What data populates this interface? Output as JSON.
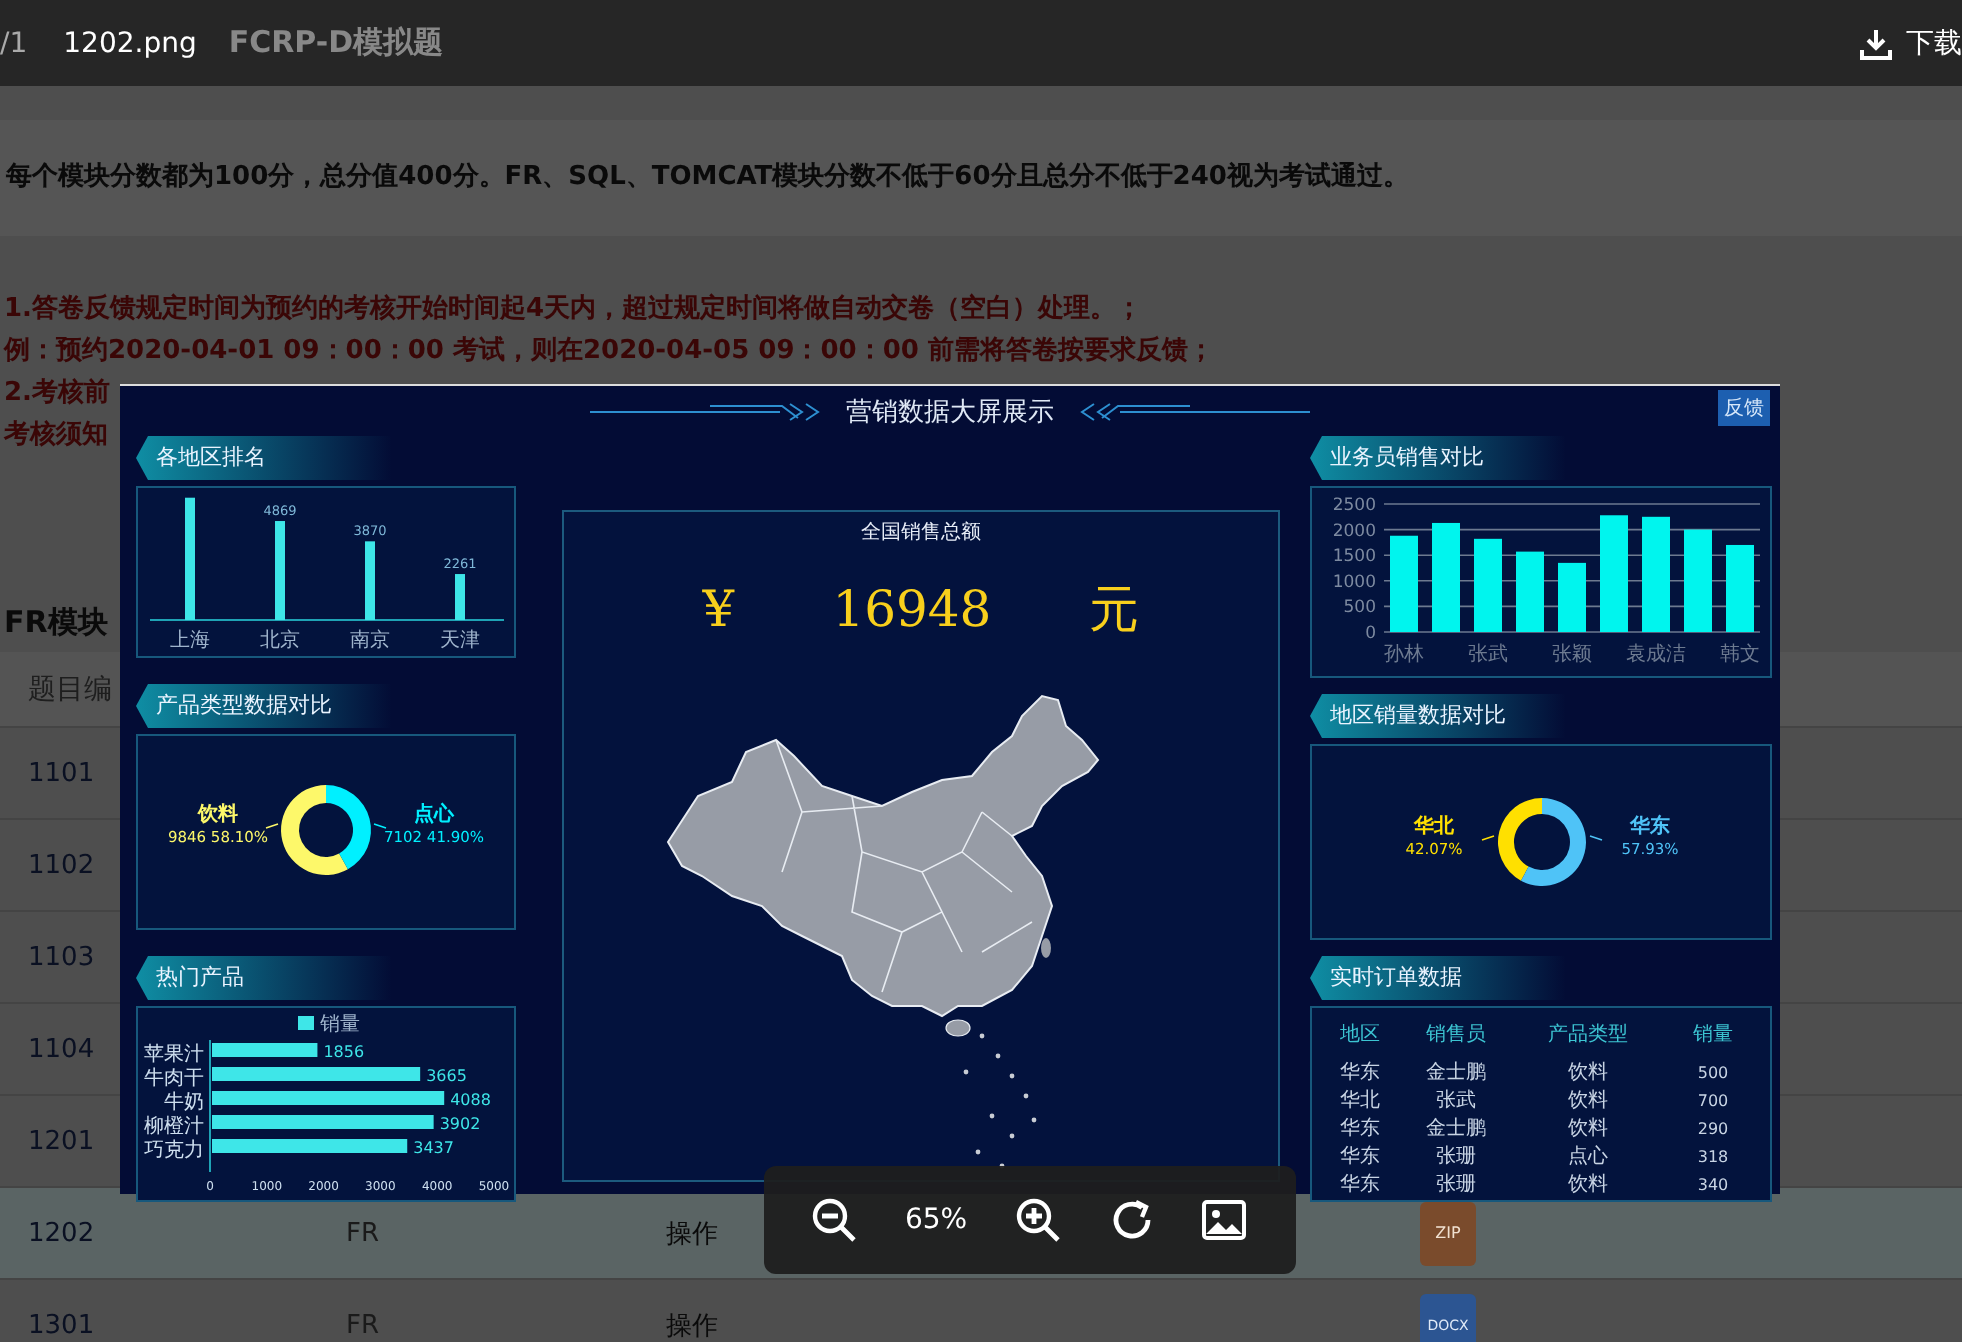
{
  "viewer": {
    "page_count": "/1",
    "file_name": "1202.png",
    "download": "下载",
    "zoom": "65%"
  },
  "page": {
    "title": "FCRP-D模拟题",
    "notice": "每个模块分数都为100分，总分值400分。FR、SQL、TOMCAT模块分数不低于60分且总分不低于240视为考试通过。",
    "rules": [
      "1.答卷反馈规定时间为预约的考核开始时间起4天内，超过规定时间将做自动交卷（空白）处理。；",
      "例：预约2020-04-01 09：00：00 考试，则在2020-04-05 09：00：00 前需将答卷按要求反馈；",
      "2.考核前",
      "考核须知"
    ],
    "section": "FR模块",
    "table": {
      "header": "题目编",
      "rows": [
        {
          "id": "1101",
          "selected": false
        },
        {
          "id": "1102",
          "selected": false
        },
        {
          "id": "1103",
          "selected": false
        },
        {
          "id": "1104",
          "selected": false
        },
        {
          "id": "1201",
          "selected": false
        },
        {
          "id": "1202",
          "module": "FR",
          "action": "操作",
          "file": {
            "kind": "zip",
            "label": "ZIP"
          },
          "selected": true
        },
        {
          "id": "1301",
          "module": "FR",
          "action": "操作",
          "file": {
            "kind": "docx",
            "label": "DOCX"
          },
          "selected": false
        }
      ]
    }
  },
  "dashboard": {
    "title": "营销数据大屏展示",
    "feedback": "反馈",
    "left_panels": [
      {
        "kind": "chart",
        "title": "各地区排名",
        "chart_data": {
          "type": "bar",
          "categories": [
            "上海",
            "北京",
            "南京",
            "天津"
          ],
          "values": [
            6016,
            4869,
            3870,
            2261
          ],
          "value_labels": [
            null,
            "4869",
            "3870",
            "2261"
          ]
        }
      },
      {
        "kind": "chart",
        "title": "产品类型数据对比",
        "chart_data": {
          "type": "donut",
          "categories": [
            "饮料",
            "点心"
          ],
          "values": [
            58.1,
            41.9
          ]
        },
        "slices": [
          {
            "value_text": "9846 58.10%",
            "color": "#fdf86a"
          },
          {
            "value_text": "7102 41.90%",
            "color": "#00f0ff"
          }
        ]
      },
      {
        "kind": "chart",
        "title": "热门产品",
        "chart_data": {
          "type": "bar",
          "orientation": "horizontal",
          "categories": [
            "苹果汁",
            "牛肉干",
            "牛奶",
            "柳橙汁",
            "巧克力"
          ],
          "series": [
            {
              "name": "销量",
              "values": [
                1856,
                3665,
                4088,
                3902,
                3437
              ]
            }
          ],
          "xlim": [
            0,
            5000
          ],
          "xticks": [
            0,
            1000,
            2000,
            3000,
            4000,
            5000
          ],
          "data_labels": true
        }
      }
    ],
    "center": {
      "title": "全国销售总额",
      "currency": "¥",
      "amount": "16948",
      "unit": "元"
    },
    "right_panels": [
      {
        "kind": "chart",
        "title": "业务员销售对比",
        "chart_data": {
          "type": "bar",
          "categories": [
            "孙林",
            null,
            "张武",
            null,
            "张颖",
            null,
            "袁成洁",
            null,
            "韩文"
          ],
          "values": [
            1880,
            2130,
            1820,
            1570,
            1350,
            2280,
            2250,
            2000,
            1700
          ],
          "ylim": [
            0,
            2500
          ],
          "yticks": [
            0,
            500,
            1000,
            1500,
            2000,
            2500
          ],
          "grid": true
        }
      },
      {
        "kind": "chart",
        "title": "地区销量数据对比",
        "chart_data": {
          "type": "donut",
          "categories": [
            "华北",
            "华东"
          ],
          "values": [
            42.07,
            57.93
          ]
        },
        "slices": [
          {
            "value_text": "42.07%",
            "color": "#ffe000"
          },
          {
            "value_text": "57.93%",
            "color": "#4fc3f7"
          }
        ]
      },
      {
        "kind": "table",
        "title": "实时订单数据",
        "columns": [
          "地区",
          "销售员",
          "产品类型",
          "销量"
        ],
        "rows": [
          [
            "华东",
            "金士鹏",
            "饮料",
            "500"
          ],
          [
            "华北",
            "张武",
            "饮料",
            "700"
          ],
          [
            "华东",
            "金士鹏",
            "饮料",
            "290"
          ],
          [
            "华东",
            "张珊",
            "点心",
            "318"
          ],
          [
            "华东",
            "张珊",
            "饮料",
            "340"
          ]
        ]
      }
    ]
  }
}
